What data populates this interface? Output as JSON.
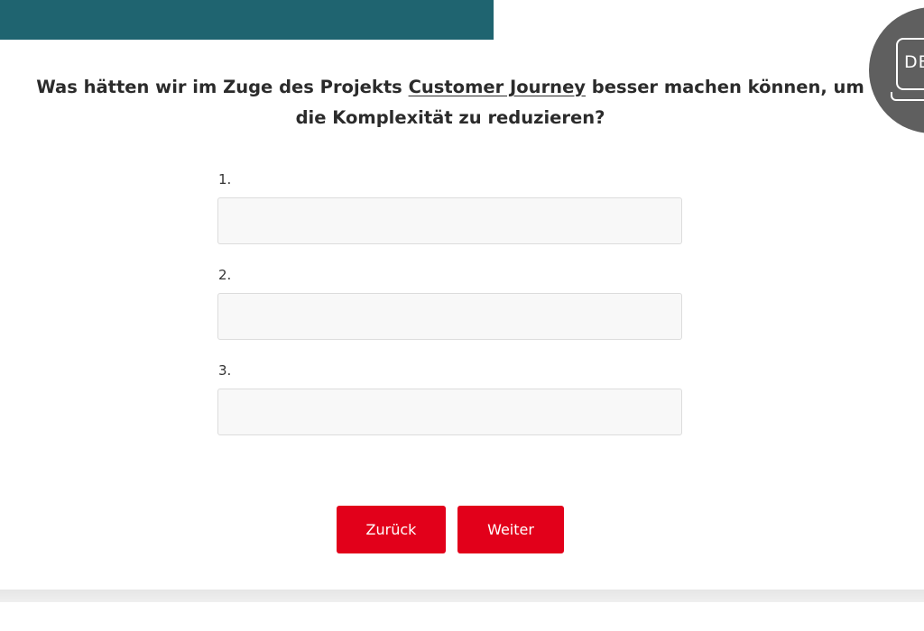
{
  "header": {
    "language_code": "DE"
  },
  "question": {
    "prefix": "Was hätten wir im Zuge des Projekts ",
    "highlight": "Customer Journey",
    "suffix": " besser machen können, um die Komplexität zu reduzieren?"
  },
  "fields": [
    {
      "label": "1.",
      "value": ""
    },
    {
      "label": "2.",
      "value": ""
    },
    {
      "label": "3.",
      "value": ""
    }
  ],
  "buttons": {
    "back_label": "Zurück",
    "next_label": "Weiter"
  },
  "colors": {
    "header_bar": "#1f6470",
    "button": "#e2001a",
    "language_badge": "#5f5f5f"
  },
  "icons": {
    "language": "laptop-icon"
  }
}
